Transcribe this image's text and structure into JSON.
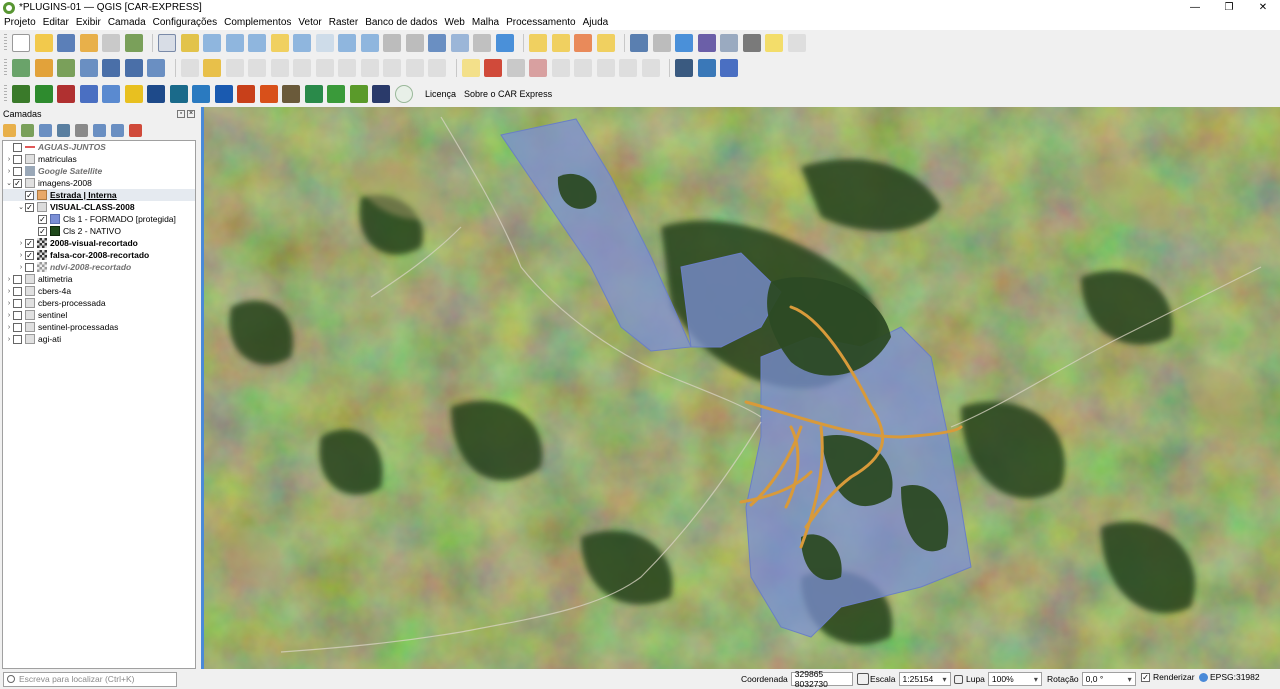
{
  "window": {
    "title": "*PLUGINS-01 — QGIS [CAR-EXPRESS]",
    "controls": [
      "—",
      "❐",
      "✕"
    ]
  },
  "menu": [
    "Projeto",
    "Editar",
    "Exibir",
    "Camada",
    "Configurações",
    "Complementos",
    "Vetor",
    "Raster",
    "Banco de dados",
    "Web",
    "Malha",
    "Processamento",
    "Ajuda"
  ],
  "toolbar3": {
    "license": "Licença",
    "about": "Sobre o CAR Express"
  },
  "layers_panel": {
    "title": "Camadas",
    "tree": [
      {
        "label": "AGUAS-JUNTOS",
        "checked": false,
        "style": "italic"
      },
      {
        "label": "matriculas",
        "checked": false
      },
      {
        "label": "Google Satellite",
        "checked": false,
        "style": "italic"
      },
      {
        "label": "imagens-2008",
        "checked": true
      },
      {
        "label": "Estrada | Interna",
        "checked": true
      },
      {
        "label": "VISUAL-CLASS-2008",
        "checked": true
      },
      {
        "label": "Cls 1 - FORMADO [protegida]",
        "checked": true
      },
      {
        "label": "Cls 2 - NATIVO",
        "checked": true
      },
      {
        "label": "2008-visual-recortado",
        "checked": true
      },
      {
        "label": "falsa-cor-2008-recortado",
        "checked": true
      },
      {
        "label": "ndvi-2008-recortado",
        "checked": false,
        "style": "italic"
      },
      {
        "label": "altimetria",
        "checked": false
      },
      {
        "label": "cbers-4a",
        "checked": false
      },
      {
        "label": "cbers-processada",
        "checked": false
      },
      {
        "label": "sentinel",
        "checked": false
      },
      {
        "label": "sentinel-processadas",
        "checked": false
      },
      {
        "label": "agi-ati",
        "checked": false
      }
    ]
  },
  "colors": {
    "formado": "#7b8fd6",
    "nativo": "#1f4a1c",
    "estrada": "#d89a3a",
    "estrada_legend": "#e8a868",
    "accent": "#3a7bd5"
  },
  "status": {
    "locator_placeholder": "Escreva para localizar (Ctrl+K)",
    "coord_label": "Coordenada",
    "coord_value": "329865 8032730",
    "scale_label": "Escala",
    "scale_value": "1:25154",
    "magnifier_label": "Lupa",
    "magnifier_value": "100%",
    "rotation_label": "Rotação",
    "rotation_value": "0,0 °",
    "render_label": "Renderizar",
    "render_checked": "✓",
    "crs": "EPSG:31982"
  }
}
